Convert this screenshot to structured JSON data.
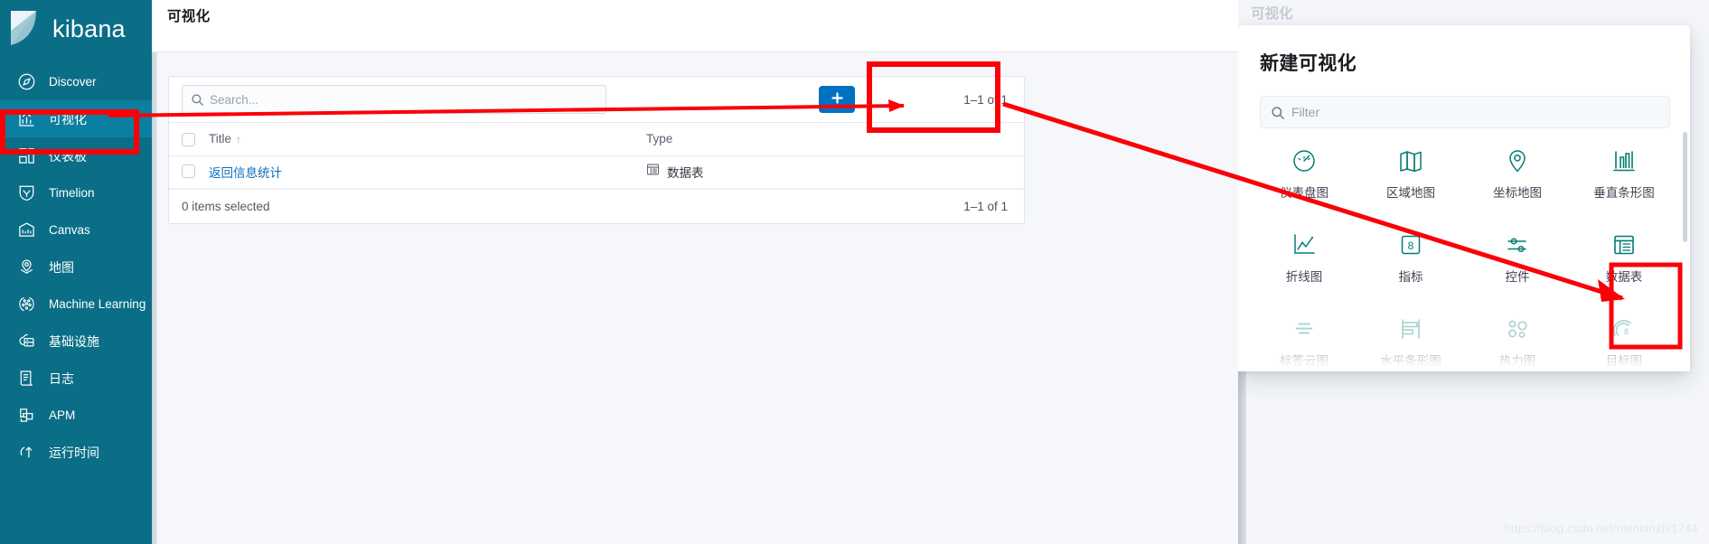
{
  "app": {
    "brand": "kibana",
    "brand_logo_icon": "kibana-logo-icon"
  },
  "sidebar": {
    "items": [
      {
        "label": "Discover",
        "icon": "compass-icon",
        "active": false
      },
      {
        "label": "可视化",
        "icon": "visualize-chart-icon",
        "active": true
      },
      {
        "label": "仪表板",
        "icon": "dashboard-grid-icon",
        "active": false
      },
      {
        "label": "Timelion",
        "icon": "timelion-shield-icon",
        "active": false
      },
      {
        "label": "Canvas",
        "icon": "canvas-frame-icon",
        "active": false
      },
      {
        "label": "地图",
        "icon": "maps-pin-layers-icon",
        "active": false
      },
      {
        "label": "Machine Learning",
        "icon": "machine-learning-icon",
        "active": false
      },
      {
        "label": "基础设施",
        "icon": "infrastructure-icon",
        "active": false
      },
      {
        "label": "日志",
        "icon": "logs-scroll-icon",
        "active": false
      },
      {
        "label": "APM",
        "icon": "apm-icon",
        "active": false
      },
      {
        "label": "运行时间",
        "icon": "uptime-arrow-icon",
        "active": false
      }
    ]
  },
  "page": {
    "title": "可视化"
  },
  "toolbar": {
    "search_value": "",
    "search_placeholder": "Search...",
    "add_button_label": "+",
    "add_button_icon": "plus-icon",
    "search_icon": "search-icon",
    "pagination": "1–1 of 1"
  },
  "table": {
    "columns": [
      {
        "key": "title",
        "label": "Title",
        "sort_indicator": "↑"
      },
      {
        "key": "type",
        "label": "Type",
        "sort_indicator": ""
      }
    ],
    "rows": [
      {
        "title": "返回信息统计",
        "type": "数据表",
        "type_icon": "data-table-icon",
        "checked": false
      }
    ],
    "footer_status": "0 items selected",
    "footer_pagination": "1–1 of 1"
  },
  "modal": {
    "ghost_title": "可视化",
    "title": "新建可视化",
    "filter_value": "",
    "filter_placeholder": "Filter",
    "filter_icon": "search-icon",
    "types": [
      {
        "label": "仪表盘图",
        "icon": "gauge-icon",
        "dim": false,
        "highlighted": false
      },
      {
        "label": "区域地图",
        "icon": "region-map-icon",
        "dim": false,
        "highlighted": false
      },
      {
        "label": "坐标地图",
        "icon": "coordinate-map-icon",
        "dim": false,
        "highlighted": false
      },
      {
        "label": "垂直条形图",
        "icon": "vertical-bar-icon",
        "dim": false,
        "highlighted": false
      },
      {
        "label": "折线图",
        "icon": "line-chart-icon",
        "dim": false,
        "highlighted": false
      },
      {
        "label": "指标",
        "icon": "metric-icon",
        "dim": false,
        "highlighted": false
      },
      {
        "label": "控件",
        "icon": "controls-icon",
        "dim": false,
        "highlighted": false
      },
      {
        "label": "数据表",
        "icon": "data-table-icon",
        "dim": false,
        "highlighted": true
      },
      {
        "label": "标签云图",
        "icon": "tag-cloud-icon",
        "dim": true,
        "highlighted": false
      },
      {
        "label": "水平条形图",
        "icon": "horizontal-bar-icon",
        "dim": true,
        "highlighted": false
      },
      {
        "label": "热力图",
        "icon": "heat-map-icon",
        "dim": true,
        "highlighted": false
      },
      {
        "label": "目标图",
        "icon": "goal-icon",
        "dim": true,
        "highlighted": false
      }
    ]
  },
  "annotations": {
    "color": "#fb0007",
    "marks": [
      "sidebar-visualize-box",
      "add-button-box",
      "data-table-box",
      "arrow-sidebar-to-add-button",
      "arrow-add-button-to-data-table"
    ]
  },
  "watermark": {
    "text": "https://blog.csdn.net/nienianzhi1744"
  },
  "colors": {
    "sidebar_bg": "#0a6e87",
    "sidebar_active": "#0c7fa0",
    "primary_button": "#0071c2",
    "link": "#0a6ebd",
    "viz_icon": "#017d73",
    "annotation_red": "#fb0007"
  }
}
